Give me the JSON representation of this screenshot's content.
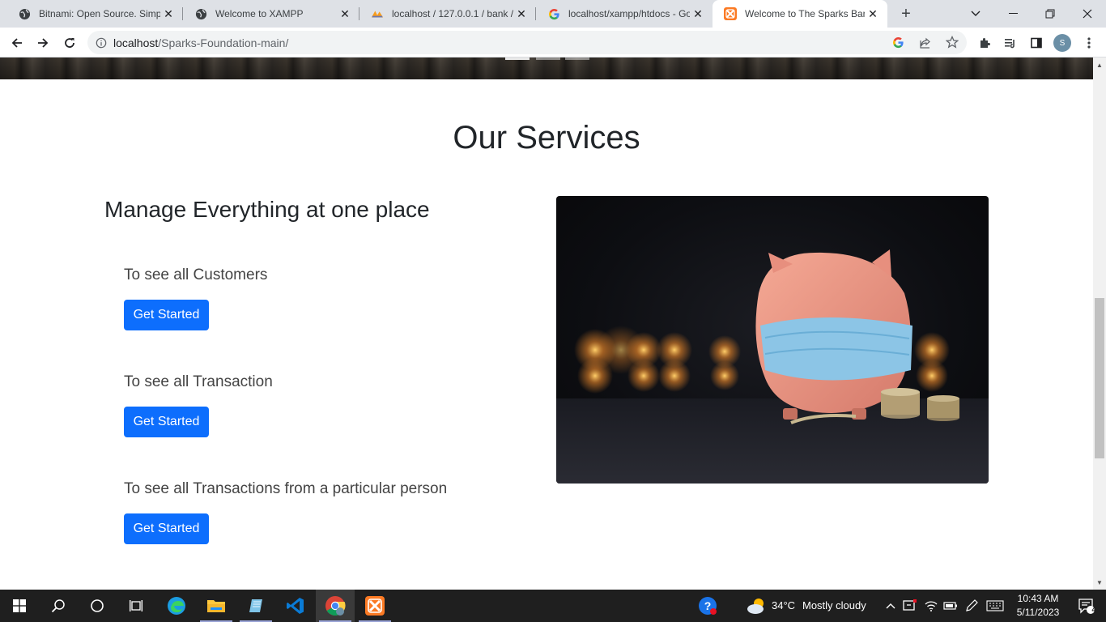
{
  "browser": {
    "tabs": [
      {
        "title": "Bitnami: Open Source. Simplified",
        "favicon": "globe-icon",
        "active": false
      },
      {
        "title": "Welcome to XAMPP",
        "favicon": "globe-icon",
        "active": false
      },
      {
        "title": "localhost / 127.0.0.1 / bank / ",
        "favicon": "phpmyadmin-icon",
        "active": false
      },
      {
        "title": "localhost/xampp/htdocs - Google Search",
        "favicon": "google-icon",
        "active": false
      },
      {
        "title": "Welcome to The Sparks Bank",
        "favicon": "xampp-icon",
        "active": true
      }
    ],
    "address_host": "localhost",
    "address_path": "/Sparks-Foundation-main/",
    "profile_initial": "S"
  },
  "page": {
    "section_title": "Our Services",
    "subtitle": "Manage Everything at one place",
    "services": [
      {
        "text": "To see all Customers",
        "button": "Get Started"
      },
      {
        "text": "To see all Transaction",
        "button": "Get Started"
      },
      {
        "text": "To see all Transactions from a particular person",
        "button": "Get Started"
      }
    ],
    "image_alt": "piggy-bank-with-mask-image"
  },
  "taskbar": {
    "weather_temp": "34°C",
    "weather_desc": "Mostly cloudy",
    "time": "10:43 AM",
    "date": "5/11/2023",
    "notification_count": "4"
  },
  "colors": {
    "primary_button": "#0d6efd",
    "heading": "#212529",
    "taskbar": "#1f1f1f"
  }
}
